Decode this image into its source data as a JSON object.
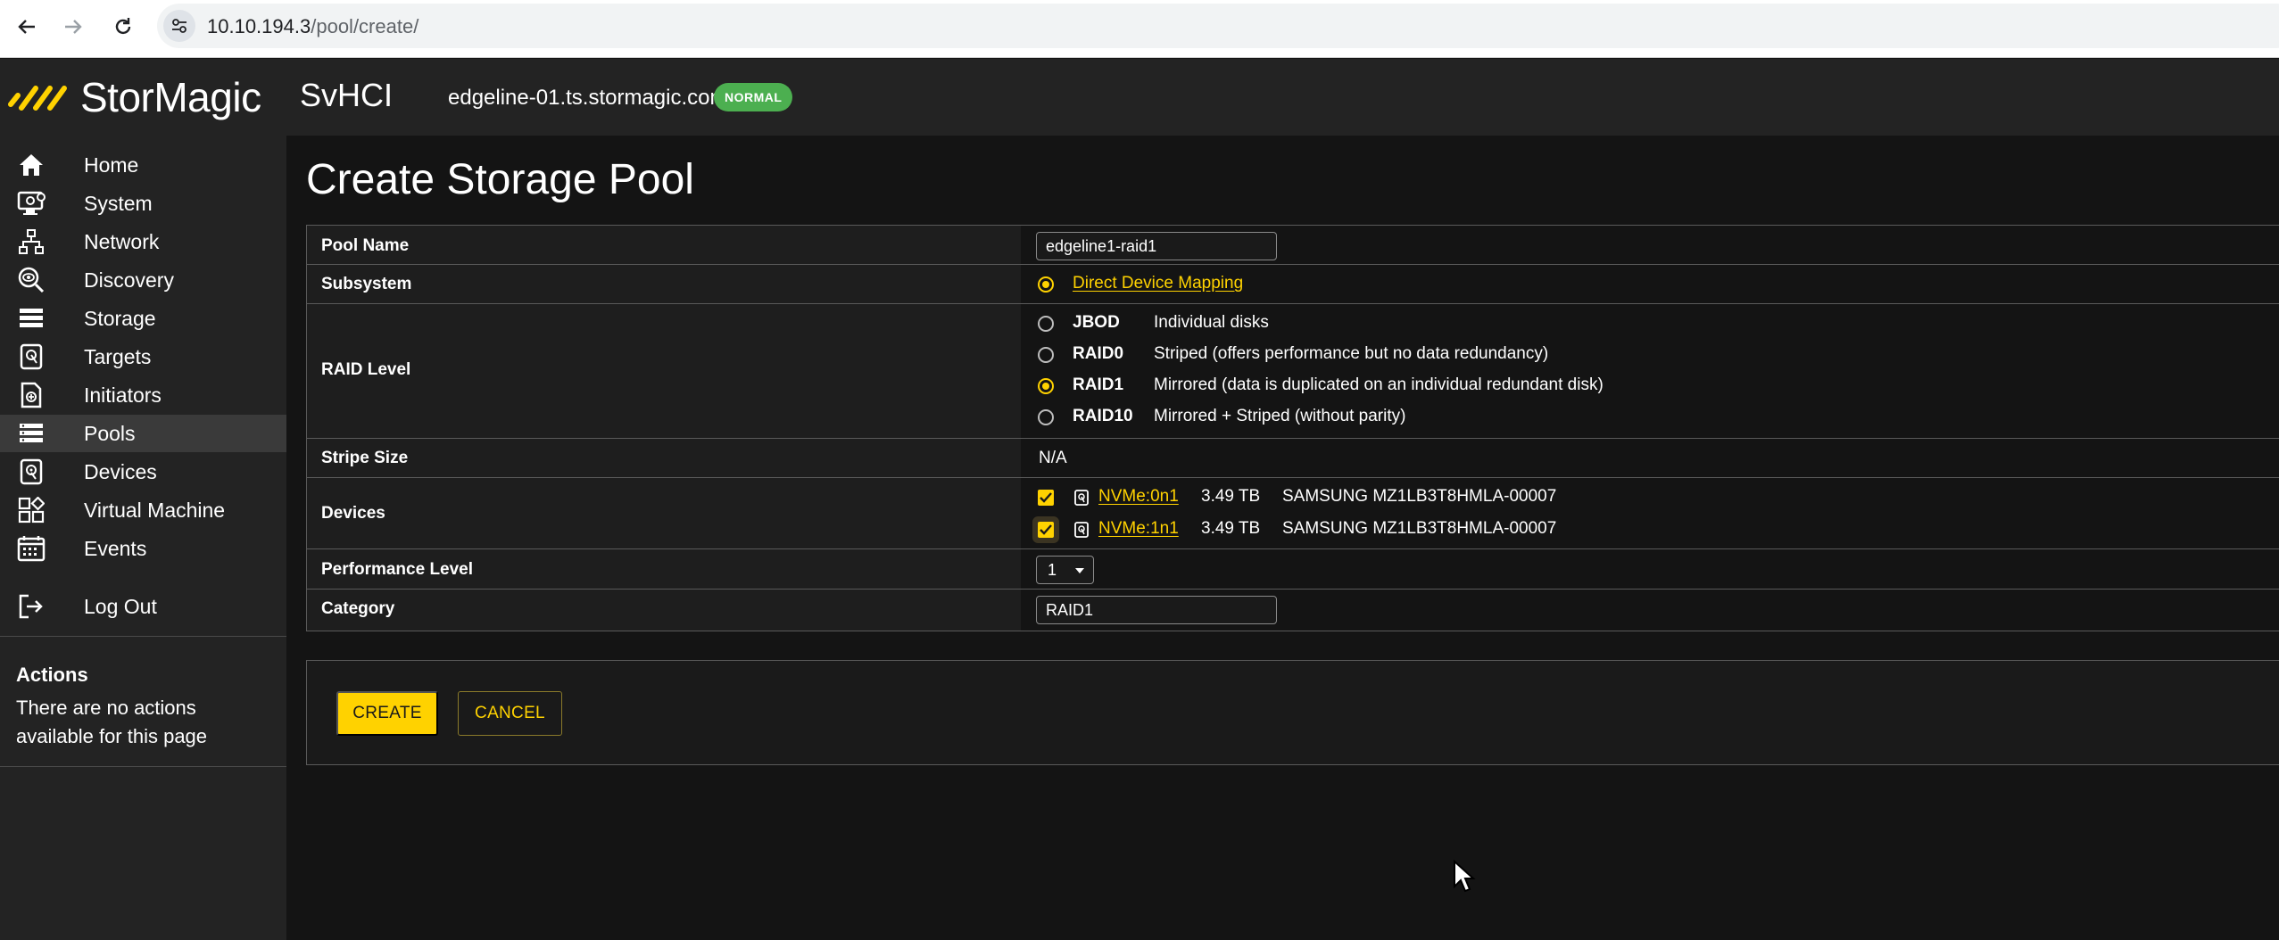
{
  "browser": {
    "url_host": "10.10.194.3",
    "url_path": "/pool/create/"
  },
  "header": {
    "logo_text": "StorMagic",
    "product": "SvHCI",
    "hostname": "edgeline-01.ts.stormagic.com",
    "status_badge": "NORMAL"
  },
  "sidebar": {
    "items": [
      {
        "label": "Home",
        "icon": "home-icon"
      },
      {
        "label": "System",
        "icon": "system-icon"
      },
      {
        "label": "Network",
        "icon": "network-icon"
      },
      {
        "label": "Discovery",
        "icon": "discovery-icon"
      },
      {
        "label": "Storage",
        "icon": "storage-icon"
      },
      {
        "label": "Targets",
        "icon": "targets-icon"
      },
      {
        "label": "Initiators",
        "icon": "initiators-icon"
      },
      {
        "label": "Pools",
        "icon": "pools-icon"
      },
      {
        "label": "Devices",
        "icon": "devices-icon"
      },
      {
        "label": "Virtual Machine",
        "icon": "virtual-machine-icon"
      },
      {
        "label": "Events",
        "icon": "events-icon"
      }
    ],
    "logout_label": "Log Out",
    "actions_title": "Actions",
    "actions_text": "There are no actions available for this page"
  },
  "page": {
    "title": "Create Storage Pool"
  },
  "form": {
    "pool_name_label": "Pool Name",
    "pool_name_value": "edgeline1-raid1",
    "subsystem_label": "Subsystem",
    "subsystem_option": "Direct Device Mapping",
    "raid_label": "RAID Level",
    "raid_options": [
      {
        "code": "JBOD",
        "desc": "Individual disks",
        "selected": false
      },
      {
        "code": "RAID0",
        "desc": "Striped (offers performance but no data redundancy)",
        "selected": false
      },
      {
        "code": "RAID1",
        "desc": "Mirrored (data is duplicated on an individual redundant disk)",
        "selected": true
      },
      {
        "code": "RAID10",
        "desc": "Mirrored + Striped (without parity)",
        "selected": false
      }
    ],
    "stripe_label": "Stripe Size",
    "stripe_value": "N/A",
    "devices_label": "Devices",
    "devices": [
      {
        "name": "NVMe:0n1",
        "size": "3.49 TB",
        "model": "SAMSUNG MZ1LB3T8HMLA-00007",
        "checked": true
      },
      {
        "name": "NVMe:1n1",
        "size": "3.49 TB",
        "model": "SAMSUNG MZ1LB3T8HMLA-00007",
        "checked": true
      }
    ],
    "performance_label": "Performance Level",
    "performance_value": "1",
    "category_label": "Category",
    "category_value": "RAID1"
  },
  "buttons": {
    "create": "CREATE",
    "cancel": "CANCEL"
  },
  "colors": {
    "accent": "#ffd200",
    "status_green": "#4caf50",
    "background": "#141414",
    "sidebar": "#232323"
  }
}
